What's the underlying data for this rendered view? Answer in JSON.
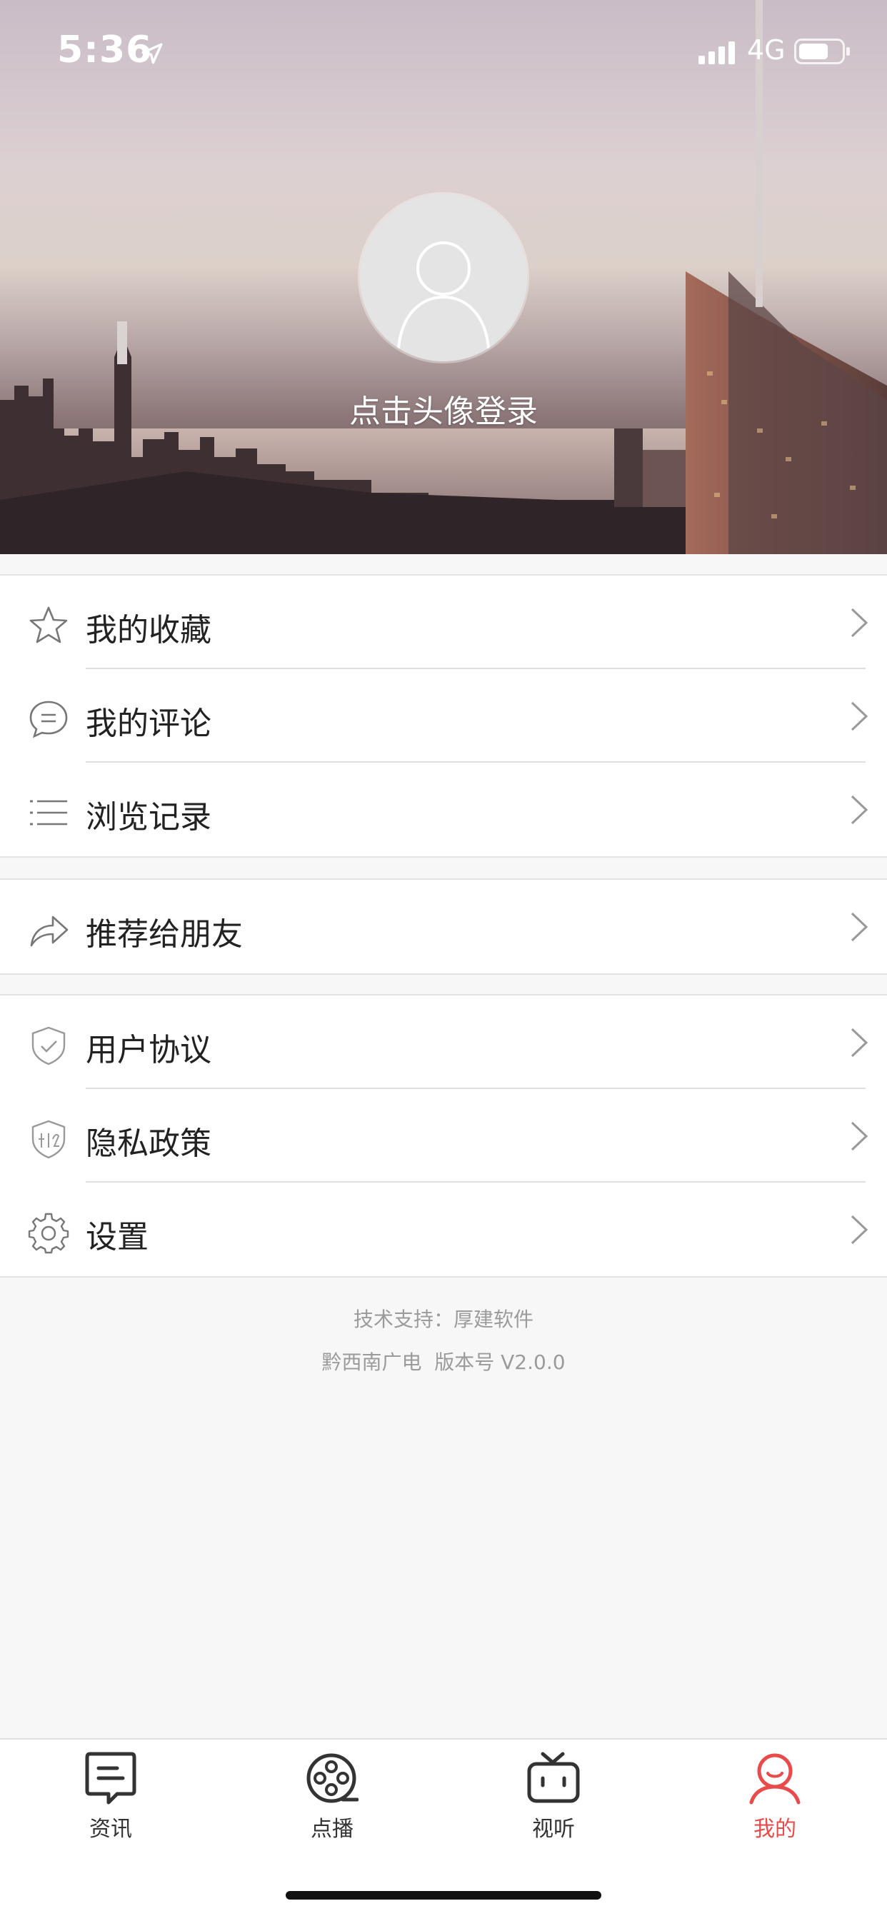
{
  "status_bar": {
    "time": "5:36",
    "network": "4G"
  },
  "profile": {
    "login_prompt": "点击头像登录"
  },
  "menu_groups": [
    {
      "items": [
        {
          "label": "我的收藏",
          "icon": "star-icon"
        },
        {
          "label": "我的评论",
          "icon": "comment-icon"
        },
        {
          "label": "浏览记录",
          "icon": "list-icon"
        }
      ]
    },
    {
      "items": [
        {
          "label": "推荐给朋友",
          "icon": "share-icon"
        }
      ]
    },
    {
      "items": [
        {
          "label": "用户协议",
          "icon": "shield-check-icon"
        },
        {
          "label": "隐私政策",
          "icon": "privacy-shield-icon"
        },
        {
          "label": "设置",
          "icon": "gear-icon"
        }
      ]
    }
  ],
  "footer": {
    "tech_support": "技术支持：厚建软件",
    "version": "黔西南广电  版本号 V2.0.0"
  },
  "tabbar": {
    "active_color": "#e94b4b",
    "tabs": [
      {
        "label": "资讯",
        "icon": "news-icon"
      },
      {
        "label": "点播",
        "icon": "film-reel-icon"
      },
      {
        "label": "视听",
        "icon": "tv-icon"
      },
      {
        "label": "我的",
        "icon": "user-icon"
      }
    ]
  }
}
